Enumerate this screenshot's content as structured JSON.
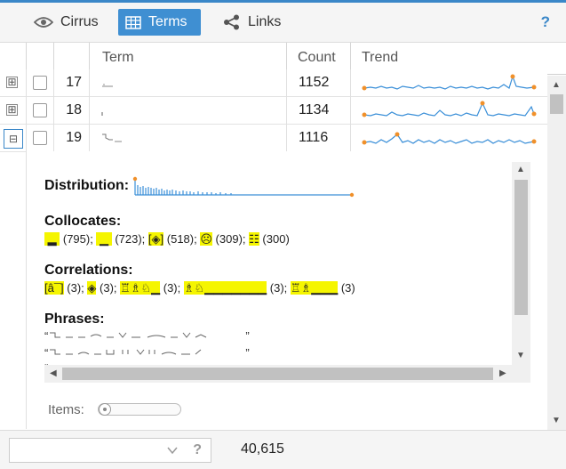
{
  "tabs": [
    {
      "label": "Cirrus",
      "icon": "eye-icon"
    },
    {
      "label": "Terms",
      "icon": "table-icon",
      "active": true
    },
    {
      "label": "Links",
      "icon": "share-icon"
    }
  ],
  "help_label": "?",
  "grid": {
    "columns": [
      "Term",
      "Count",
      "Trend"
    ],
    "rows": [
      {
        "num": "17",
        "count": "1152",
        "expander": "⊞"
      },
      {
        "num": "18",
        "count": "1134",
        "expander": "⊞"
      },
      {
        "num": "19",
        "count": "1116",
        "expander": "⊟"
      }
    ]
  },
  "detail": {
    "distribution_label": "Distribution:",
    "collocates_label": "Collocates:",
    "collocates": [
      "(795);",
      "(723);",
      "(518);",
      "(309);",
      "(300)"
    ],
    "correlations_label": "Correlations:",
    "correlations": [
      "(3);",
      "(3);",
      "(3);",
      "(3);",
      "(3)"
    ],
    "correlation_first_glyph": "[â¯]",
    "phrases_label": "Phrases:",
    "phrase_open": "“",
    "phrase_close": "”",
    "items_label": "Items:"
  },
  "footer": {
    "total": "40,615",
    "help": "?"
  },
  "colors": {
    "accent": "#3f8fd2",
    "highlight": "#f5f500",
    "spark_line": "#3a8fd8",
    "spark_dot": "#f0902a"
  }
}
